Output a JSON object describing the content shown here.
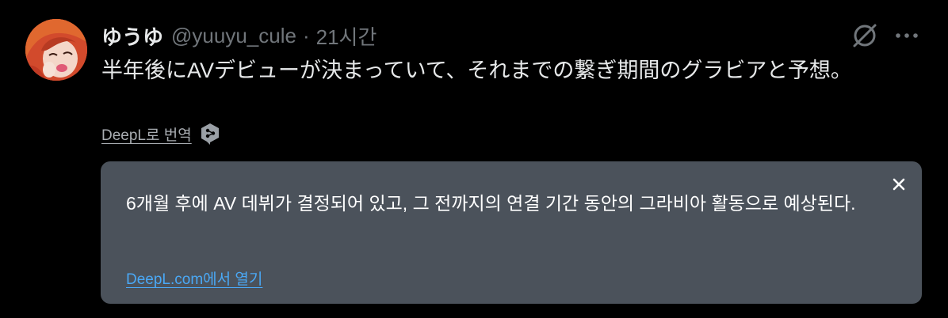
{
  "tweet": {
    "display_name": "ゆうゆ",
    "handle": "@yuuyu_cule",
    "separator": "·",
    "time": "21시간",
    "text": "半年後にAVデビューが決まっていて、それまでの繋ぎ期間のグラビアと予想。",
    "icons": [
      "avatar",
      "hide-post-icon",
      "more-options-icon"
    ]
  },
  "translate": {
    "link_label": "DeepL로 번역",
    "icon": "deepl-icon"
  },
  "translation_card": {
    "text": "6개월 후에 AV 데뷔가 결정되어 있고, 그 전까지의 연결 기간 동안의 그라비아 활동으로 예상된다.",
    "open_link": "DeepL.com에서 열기",
    "close_icon": "close-icon"
  },
  "colors": {
    "background": "#000000",
    "primary_text": "#e7e9ea",
    "secondary_text": "#71767b",
    "card_background": "#4b525b",
    "link": "#4aa8f5"
  }
}
